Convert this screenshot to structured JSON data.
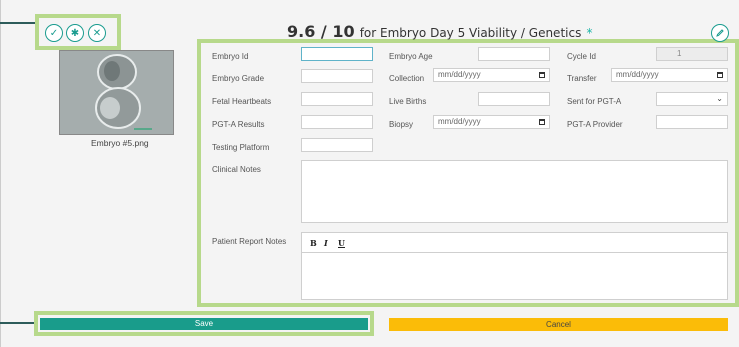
{
  "header": {
    "score": "9.6 / 10",
    "title_rest": "for Embryo Day 5 Viability / Genetics",
    "required_mark": "*",
    "actions": [
      "check-icon",
      "asterisk-icon",
      "close-icon"
    ]
  },
  "image": {
    "caption": "Embryo #5.png"
  },
  "form": {
    "embryo_id": {
      "label": "Embryo Id",
      "value": ""
    },
    "embryo_age": {
      "label": "Embryo Age",
      "value": ""
    },
    "cycle_id": {
      "label": "Cycle Id",
      "value": "1"
    },
    "embryo_grade": {
      "label": "Embryo Grade",
      "value": ""
    },
    "collection": {
      "label": "Collection",
      "placeholder": "mm/dd/yyyy"
    },
    "transfer": {
      "label": "Transfer",
      "placeholder": "mm/dd/yyyy"
    },
    "fetal_heartbeats": {
      "label": "Fetal Heartbeats",
      "value": ""
    },
    "live_births": {
      "label": "Live Births",
      "value": ""
    },
    "sent_for_pgta": {
      "label": "Sent for PGT-A",
      "value": ""
    },
    "pgta_results": {
      "label": "PGT-A Results",
      "value": ""
    },
    "biopsy": {
      "label": "Biopsy",
      "placeholder": "mm/dd/yyyy"
    },
    "pgta_provider": {
      "label": "PGT-A Provider",
      "value": ""
    },
    "testing_platform": {
      "label": "Testing Platform",
      "value": ""
    },
    "clinical_notes": {
      "label": "Clinical Notes",
      "value": ""
    },
    "patient_report_notes": {
      "label": "Patient Report Notes",
      "toolbar": [
        "B",
        "I",
        "U"
      ]
    }
  },
  "buttons": {
    "save": "Save",
    "cancel": "Cancel"
  },
  "colors": {
    "accent": "#199c8b",
    "cancel": "#fbbc08",
    "highlight": "#b7d98b"
  }
}
